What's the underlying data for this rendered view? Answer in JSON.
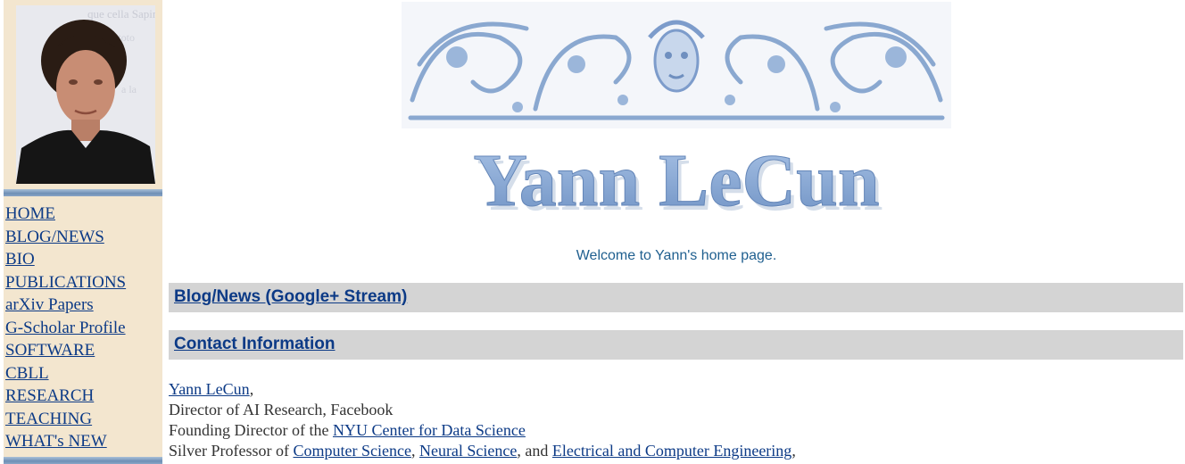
{
  "colors": {
    "sidebar_bg": "#f3e6cf",
    "link": "#0c3a86",
    "section_bar": "#d4d4d4",
    "banner_blue": "#8aa8d0",
    "welcome_text": "#1f5f8f"
  },
  "sidebar": {
    "photo_icon": "portrait-photo",
    "nav": [
      {
        "label": "HOME"
      },
      {
        "label": "BLOG/NEWS"
      },
      {
        "label": "BIO"
      },
      {
        "label": "PUBLICATIONS"
      },
      {
        "label": "arXiv Papers"
      },
      {
        "label": "G-Scholar Profile"
      },
      {
        "label": "SOFTWARE"
      },
      {
        "label": "CBLL"
      },
      {
        "label": "RESEARCH"
      },
      {
        "label": "TEACHING"
      },
      {
        "label": "WHAT's NEW"
      }
    ]
  },
  "banner": {
    "title": "Yann LeCun",
    "ornament_icon": "ornamental-engraving"
  },
  "welcome": "Welcome to Yann's home page.",
  "sections": {
    "blog": "Blog/News (Google+ Stream)",
    "contact": "Contact Information"
  },
  "contact": {
    "name_link": "Yann LeCun",
    "name_suffix": ",",
    "line2": "Director of AI Research, Facebook",
    "line3_prefix": "Founding Director of the ",
    "line3_link": "NYU Center for Data Science",
    "line4_prefix": "Silver Professor of ",
    "line4_link1": "Computer Science",
    "line4_sep1": ", ",
    "line4_link2": "Neural Science",
    "line4_sep2": ", and ",
    "line4_link3": "Electrical and Computer Engineering",
    "line4_suffix": ","
  }
}
